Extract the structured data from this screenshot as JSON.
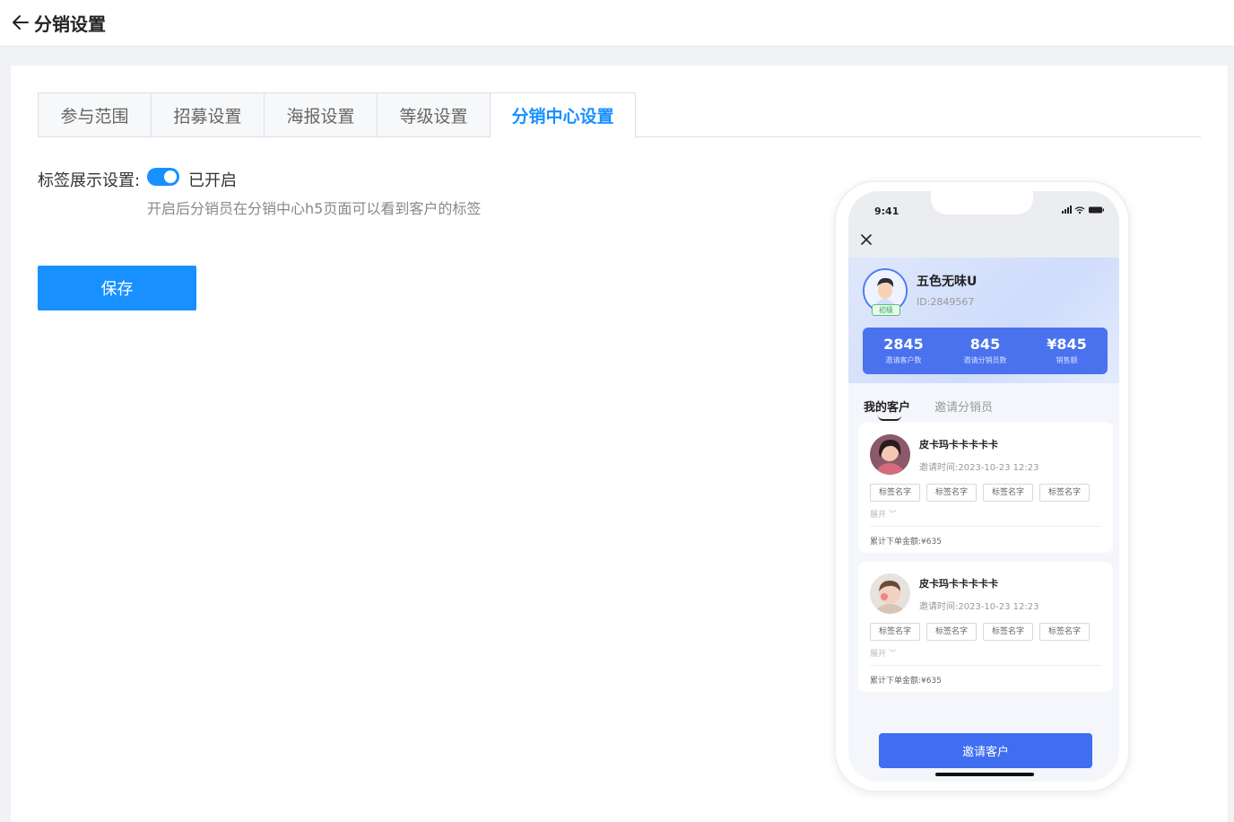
{
  "header": {
    "title": "分销设置",
    "back_icon": "arrow-left-icon"
  },
  "tabs": [
    {
      "label": "参与范围",
      "active": false
    },
    {
      "label": "招募设置",
      "active": false
    },
    {
      "label": "海报设置",
      "active": false
    },
    {
      "label": "等级设置",
      "active": false
    },
    {
      "label": "分销中心设置",
      "active": true
    }
  ],
  "settings": {
    "tag_display_label": "标签展示设置:",
    "switch_on": true,
    "switch_text": "已开启",
    "hint": "开启后分销员在分销中心h5页面可以看到客户的标签",
    "save_label": "保存"
  },
  "colors": {
    "primary": "#1890ff",
    "phone_button": "#3f6ef0"
  },
  "phone": {
    "time": "9:41",
    "status_icons": "signal-wifi-battery-icons",
    "user": {
      "name": "五色无味U",
      "id": "ID:2849567",
      "level": "初级"
    },
    "stats": [
      {
        "value": "2845",
        "label": "邀请客户数"
      },
      {
        "value": "845",
        "label": "邀请分销员数"
      },
      {
        "value": "¥845",
        "label": "销售额"
      }
    ],
    "tabs": {
      "active": "我的客户",
      "other": "邀请分销员"
    },
    "customers": [
      {
        "name": "皮卡玛卡卡卡卡卡",
        "time": "邀请时间:2023-10-23 12:23",
        "tags": [
          "标签名字",
          "标签名字",
          "标签名字",
          "标签名字"
        ],
        "expand": "展开 ﹀",
        "total": "累计下单金额:¥635"
      },
      {
        "name": "皮卡玛卡卡卡卡卡",
        "time": "邀请时间:2023-10-23 12:23",
        "tags": [
          "标签名字",
          "标签名字",
          "标签名字",
          "标签名字"
        ],
        "expand": "展开 ﹀",
        "total": "累计下单金额:¥635"
      }
    ],
    "invite_label": "邀请客户"
  }
}
